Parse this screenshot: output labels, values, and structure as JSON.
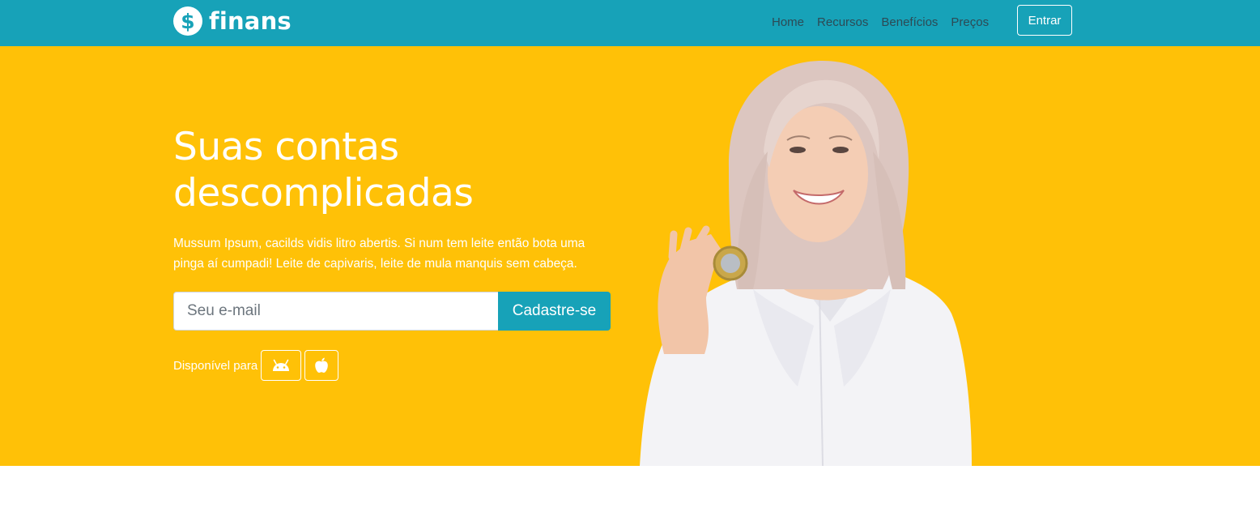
{
  "header": {
    "brand": {
      "logo_glyph": "$",
      "name": "finans"
    },
    "nav": [
      {
        "label": "Home"
      },
      {
        "label": "Recursos"
      },
      {
        "label": "Benefícios"
      },
      {
        "label": "Preços"
      }
    ],
    "login_label": "Entrar"
  },
  "hero": {
    "title_line1": "Suas contas",
    "title_line2": "descomplicadas",
    "text": "Mussum Ipsum, cacilds vidis litro abertis. Si num tem leite então bota uma pinga aí cumpadi! Leite de capivaris, leite de mula manquis sem cabeça.",
    "email_placeholder": "Seu e-mail",
    "signup_label": "Cadastre-se",
    "available_label": "Disponível para",
    "stores": [
      {
        "icon": "android-icon"
      },
      {
        "icon": "apple-icon"
      }
    ]
  },
  "colors": {
    "primary": "#17a2b8",
    "hero_background": "#ffc107",
    "text_on_color": "#ffffff",
    "nav_link": "#2d4a55"
  }
}
